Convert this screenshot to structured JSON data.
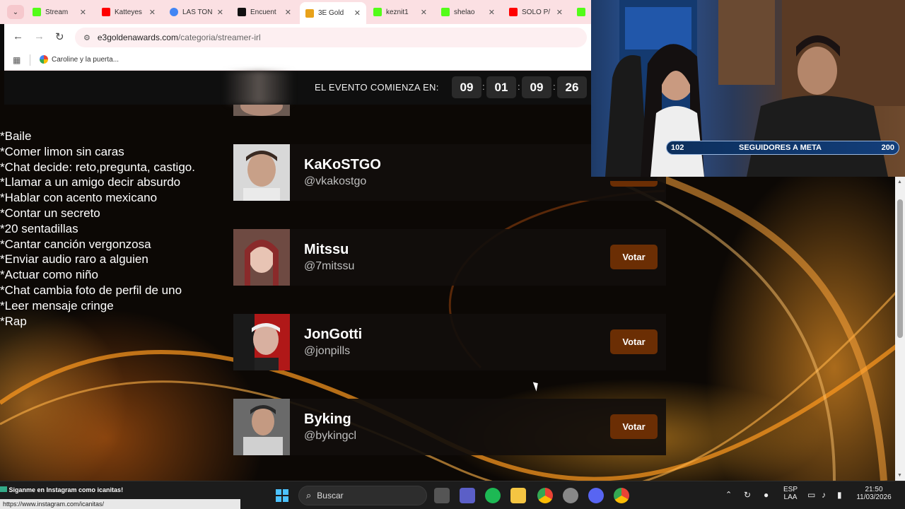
{
  "browser": {
    "tabs": [
      {
        "label": "Stream",
        "icon": "kick-icon",
        "color": "#53fc18"
      },
      {
        "label": "Katteyes",
        "icon": "youtube-icon",
        "color": "#ff0000"
      },
      {
        "label": "LAS TON",
        "icon": "google-icon",
        "color": "#4285f4"
      },
      {
        "label": "Encuent",
        "icon": "tiktok-icon",
        "color": "#111111"
      },
      {
        "label": "3E Gold",
        "icon": "3e-icon",
        "color": "#e8a21a"
      },
      {
        "label": "keznit1",
        "icon": "kick-icon",
        "color": "#53fc18"
      },
      {
        "label": "shelao",
        "icon": "kick-icon",
        "color": "#53fc18"
      },
      {
        "label": "SOLO P/",
        "icon": "youtube-icon",
        "color": "#ff0000"
      }
    ],
    "url_host": "e3goldenawards.com",
    "url_path": "/categoria/streamer-irl",
    "bookmark": "Caroline y la puerta..."
  },
  "countdown": {
    "label": "EL EVENTO COMIENZA EN:",
    "values": [
      "09",
      "01",
      "09",
      "26"
    ]
  },
  "overlay_list": [
    "*Baile",
    "*Comer limon sin caras",
    "*Chat decide: reto,pregunta, castigo.",
    "*Llamar a un amigo decir absurdo",
    "*Hablar con acento mexicano",
    "*Contar un secreto",
    "*20 sentadillas",
    "*Cantar canción vergonzosa",
    "*Enviar audio raro a alguien",
    "*Actuar como niño",
    "*Chat cambia foto de perfil de uno",
    "*Leer mensaje cringe",
    "*Rap"
  ],
  "nominees": [
    {
      "name": "KaKoSTGO",
      "handle": "@vkakostgo",
      "vote": ""
    },
    {
      "name": "Mitssu",
      "handle": "@7mitssu",
      "vote": "Votar"
    },
    {
      "name": "JonGotti",
      "handle": "@jonpills",
      "vote": "Votar"
    },
    {
      "name": "Byking",
      "handle": "@bykingcl",
      "vote": "Votar"
    }
  ],
  "meta_bar": {
    "current": "102",
    "label": "SEGUIDORES A META",
    "goal": "200"
  },
  "taskbar": {
    "search": "Buscar",
    "lang_top": "ESP",
    "lang_bottom": "LAA",
    "time": "21:50",
    "date": "11/03/2026"
  },
  "notification": {
    "text": "Siganme en Instagram como icanitas!",
    "url": "https://www.instagram.com/icanitas/"
  }
}
